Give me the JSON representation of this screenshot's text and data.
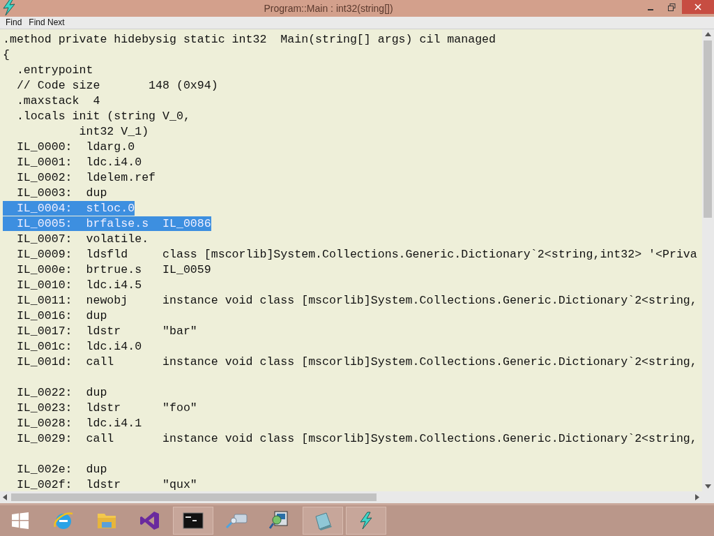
{
  "window": {
    "title": "Program::Main : int32(string[])"
  },
  "menu": [
    {
      "label": "Find"
    },
    {
      "label": "Find Next"
    }
  ],
  "code_lines": [
    {
      "kind": "code",
      "text": ".method private hidebysig static int32  Main(string[] args) cil managed",
      "selected": false
    },
    {
      "kind": "code",
      "text": "{",
      "selected": false
    },
    {
      "kind": "code",
      "text": "  .entrypoint",
      "selected": false
    },
    {
      "kind": "code",
      "text": "  // Code size       148 (0x94)",
      "selected": false
    },
    {
      "kind": "code",
      "text": "  .maxstack  4",
      "selected": false
    },
    {
      "kind": "code",
      "text": "  .locals init (string V_0,",
      "selected": false
    },
    {
      "kind": "code",
      "text": "           int32 V_1)",
      "selected": false
    },
    {
      "kind": "code",
      "text": "  IL_0000:  ldarg.0",
      "selected": false
    },
    {
      "kind": "code",
      "text": "  IL_0001:  ldc.i4.0",
      "selected": false
    },
    {
      "kind": "code",
      "text": "  IL_0002:  ldelem.ref",
      "selected": false
    },
    {
      "kind": "code",
      "text": "  IL_0003:  dup",
      "selected": false
    },
    {
      "kind": "code",
      "text": "  IL_0004:  stloc.0",
      "selected": true
    },
    {
      "kind": "code",
      "text": "  IL_0005:  brfalse.s  IL_0086",
      "selected": true
    },
    {
      "kind": "code",
      "text": "  IL_0007:  volatile.",
      "selected": false
    },
    {
      "kind": "code",
      "text": "  IL_0009:  ldsfld     class [mscorlib]System.Collections.Generic.Dictionary`2<string,int32> '<Priva",
      "selected": false
    },
    {
      "kind": "code",
      "text": "  IL_000e:  brtrue.s   IL_0059",
      "selected": false
    },
    {
      "kind": "code",
      "text": "  IL_0010:  ldc.i4.5",
      "selected": false
    },
    {
      "kind": "code",
      "text": "  IL_0011:  newobj     instance void class [mscorlib]System.Collections.Generic.Dictionary`2<string,",
      "selected": false
    },
    {
      "kind": "code",
      "text": "  IL_0016:  dup",
      "selected": false
    },
    {
      "kind": "code",
      "text": "  IL_0017:  ldstr      \"bar\"",
      "selected": false
    },
    {
      "kind": "code",
      "text": "  IL_001c:  ldc.i4.0",
      "selected": false
    },
    {
      "kind": "code",
      "text": "  IL_001d:  call       instance void class [mscorlib]System.Collections.Generic.Dictionary`2<string,",
      "selected": false
    },
    {
      "kind": "blank"
    },
    {
      "kind": "code",
      "text": "  IL_0022:  dup",
      "selected": false
    },
    {
      "kind": "code",
      "text": "  IL_0023:  ldstr      \"foo\"",
      "selected": false
    },
    {
      "kind": "code",
      "text": "  IL_0028:  ldc.i4.1",
      "selected": false
    },
    {
      "kind": "code",
      "text": "  IL_0029:  call       instance void class [mscorlib]System.Collections.Generic.Dictionary`2<string,",
      "selected": false
    },
    {
      "kind": "blank"
    },
    {
      "kind": "code",
      "text": "  IL_002e:  dup",
      "selected": false
    },
    {
      "kind": "code",
      "text": "  IL_002f:  ldstr      \"qux\"",
      "selected": false
    }
  ],
  "taskbar": [
    {
      "kind": "start",
      "active": false
    },
    {
      "kind": "browser",
      "active": false
    },
    {
      "kind": "folder",
      "active": false
    },
    {
      "kind": "studio",
      "active": false
    },
    {
      "kind": "console",
      "active": true
    },
    {
      "kind": "network",
      "active": false
    },
    {
      "kind": "monitor",
      "active": false
    },
    {
      "kind": "box",
      "active": true
    },
    {
      "kind": "bolt",
      "active": true
    }
  ]
}
